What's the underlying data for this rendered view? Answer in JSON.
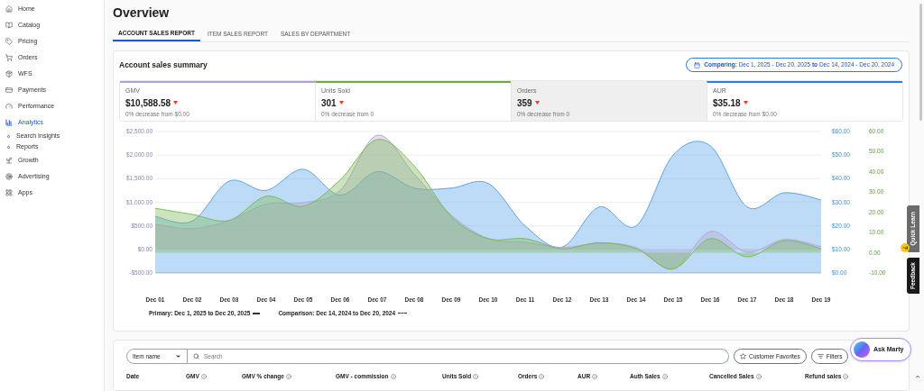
{
  "sidebar": {
    "items": [
      {
        "label": "Home",
        "selected": false
      },
      {
        "label": "Catalog",
        "selected": false
      },
      {
        "label": "Pricing",
        "selected": false
      },
      {
        "label": "Orders",
        "selected": false
      },
      {
        "label": "WFS",
        "selected": false
      },
      {
        "label": "Payments",
        "selected": false
      },
      {
        "label": "Performance",
        "selected": false
      },
      {
        "label": "Analytics",
        "selected": true,
        "children": [
          {
            "label": "Search Insights",
            "selected": false
          },
          {
            "label": "Reports",
            "selected": false
          }
        ]
      },
      {
        "label": "Growth",
        "selected": false
      },
      {
        "label": "Advertising",
        "selected": false
      },
      {
        "label": "Apps",
        "selected": false
      }
    ]
  },
  "page": {
    "title": "Overview"
  },
  "tabs": [
    {
      "label": "ACCOUNT SALES REPORT",
      "selected": true
    },
    {
      "label": "ITEM SALES REPORT",
      "selected": false
    },
    {
      "label": "SALES BY DEPARTMENT",
      "selected": false
    }
  ],
  "summary": {
    "title": "Account sales summary",
    "comparing": "**Comparing:** Dec 1, 2025 - Dec 20, 2025 **to** Dec 14, 2024 - Dec 20, 2024",
    "metrics": [
      {
        "label": "GMV",
        "value": "$10,588.58",
        "change": "0% decrease from $0.00",
        "selected": true,
        "color": "#b39ddb"
      },
      {
        "label": "Units Sold",
        "value": "301",
        "change": "0% decrease from 0",
        "selected": true,
        "color": "#6aaf3d"
      },
      {
        "label": "Orders",
        "value": "359",
        "change": "0% decrease from 0",
        "selected": false
      },
      {
        "label": "AUR",
        "value": "$35.18",
        "change": "0% decrease from $0.00",
        "selected": true,
        "color": "#2f7de1"
      }
    ],
    "chart_data": {
      "type": "area",
      "categories": [
        "Dec 01",
        "Dec 02",
        "Dec 03",
        "Dec 04",
        "Dec 05",
        "Dec 06",
        "Dec 07",
        "Dec 08",
        "Dec 09",
        "Dec 10",
        "Dec 11",
        "Dec 12",
        "Dec 13",
        "Dec 14",
        "Dec 15",
        "Dec 16",
        "Dec 17",
        "Dec 18",
        "Dec 19"
      ],
      "ylim": [
        -500,
        2500
      ],
      "grid": true,
      "yticks": [
        {
          "value": 2500,
          "label": "$2,500.00"
        },
        {
          "value": 2000,
          "label": "$2,000.00"
        },
        {
          "value": 1500,
          "label": "$1,500.00"
        },
        {
          "value": 1000,
          "label": "$1,000.00"
        },
        {
          "value": 500,
          "label": "$500.00"
        },
        {
          "value": 0,
          "label": "$0.00"
        },
        {
          "value": -500,
          "label": "-$500.00"
        }
      ],
      "y2lim": [
        0,
        60
      ],
      "y3lim": [
        -10,
        60
      ],
      "y2ticks": [
        {
          "value": 60,
          "label": "$60.00"
        },
        {
          "value": 50,
          "label": "$50.00"
        },
        {
          "value": 40,
          "label": "$40.00"
        },
        {
          "value": 30,
          "label": "$30.00"
        },
        {
          "value": 20,
          "label": "$20.00"
        },
        {
          "value": 10,
          "label": "$10.00"
        },
        {
          "value": 0,
          "label": "$0.00"
        }
      ],
      "y3ticks": [
        {
          "value": 60,
          "label": "60.00"
        },
        {
          "value": 50,
          "label": "50.00"
        },
        {
          "value": 40,
          "label": "40.00"
        },
        {
          "value": 30,
          "label": "30.00"
        },
        {
          "value": 20,
          "label": "20.00"
        },
        {
          "value": 10,
          "label": "10.00"
        },
        {
          "value": 0,
          "label": "0.00"
        },
        {
          "value": -10,
          "label": "-10.00"
        }
      ],
      "series": [
        {
          "color": "#5ba4ea",
          "axis": "y2",
          "values": [
            24,
            22,
            39,
            35,
            44,
            33,
            43,
            36,
            36,
            38,
            20,
            11,
            28,
            20,
            50,
            54,
            28,
            34,
            31
          ]
        },
        {
          "color": "#b9a6d8",
          "values": [
            530,
            440,
            610,
            960,
            990,
            1250,
            2420,
            1600,
            730,
            230,
            150,
            40,
            130,
            40,
            -420,
            380,
            -60,
            210,
            60
          ]
        },
        {
          "color": "#7cbb5a",
          "axis": "y3",
          "values": [
            22,
            19,
            16,
            28,
            23,
            36,
            56,
            43,
            18,
            7,
            7,
            2,
            5,
            2,
            -8,
            7,
            -2,
            6,
            2
          ]
        }
      ]
    },
    "legend": [
      {
        "label": "Primary: Dec 1, 2025 to Dec 20, 2025",
        "kind": "solid"
      },
      {
        "label": "Comparison: Dec 14, 2024 to Dec 20, 2024",
        "kind": "dashed"
      }
    ]
  },
  "table": {
    "filter": {
      "dropdown": "Item name",
      "search_placeholder": "Search",
      "buttons": [
        "Customer Favorites",
        "Filters"
      ]
    },
    "columns": [
      {
        "label": "Date",
        "info": false
      },
      {
        "label": "GMV",
        "info": true
      },
      {
        "label": "GMV % change",
        "info": true
      },
      {
        "label": "GMV - commission",
        "info": true
      },
      {
        "label": "Units Sold",
        "info": true
      },
      {
        "label": "Orders",
        "info": true
      },
      {
        "label": "AUR",
        "info": true
      },
      {
        "label": "Auth Sales",
        "info": true
      },
      {
        "label": "Cancelled Sales",
        "info": true
      },
      {
        "label": "Refund sales",
        "info": true
      }
    ]
  },
  "side_tabs": [
    {
      "label": "Quick Learn",
      "kind": "light"
    },
    {
      "label": "Feedback",
      "kind": "dark"
    }
  ],
  "help_badge": "?",
  "assistant": {
    "label": "Ask Marty"
  }
}
